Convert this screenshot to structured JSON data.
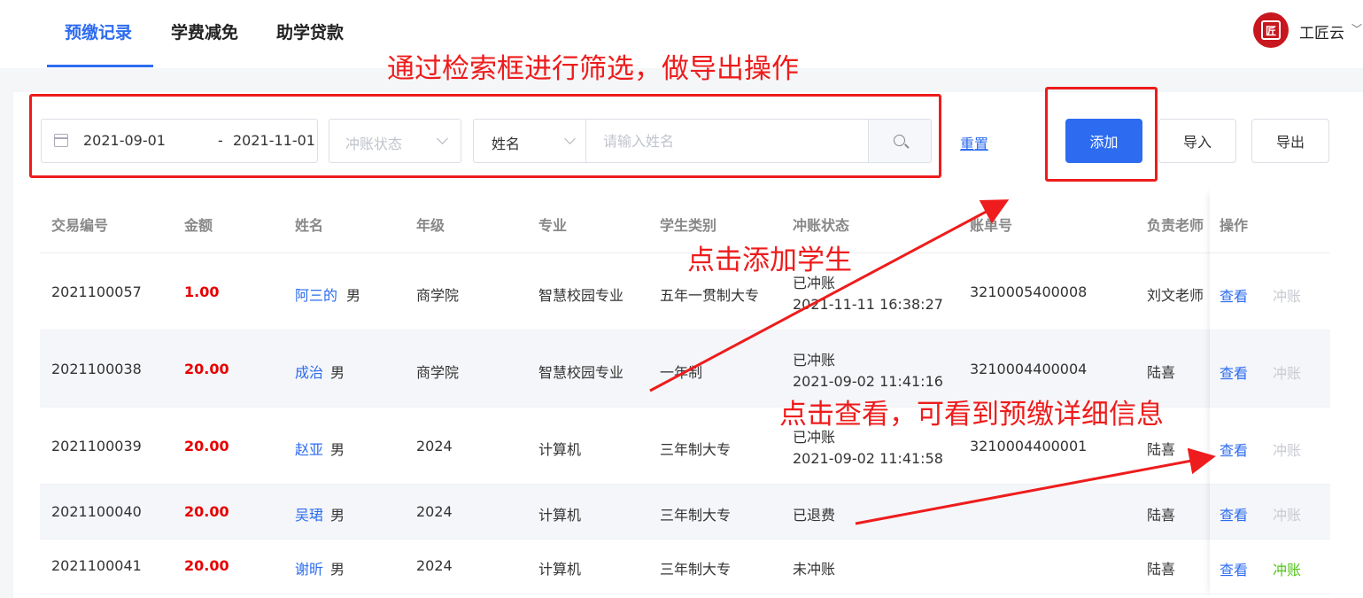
{
  "tabs": [
    {
      "label": "预缴记录",
      "active": true
    },
    {
      "label": "学费减免",
      "active": false
    },
    {
      "label": "助学贷款",
      "active": false
    }
  ],
  "brand": {
    "logo_char": "匠",
    "name": "工匠云"
  },
  "filters": {
    "date_start": "2021-09-01",
    "date_sep": "-",
    "date_end": "2021-11-01",
    "status_placeholder": "冲账状态",
    "search_field": "姓名",
    "name_placeholder": "请输入姓名"
  },
  "actions": {
    "reset": "重置",
    "add": "添加",
    "import": "导入",
    "export": "导出"
  },
  "table": {
    "headers": [
      "交易编号",
      "金额",
      "姓名",
      "年级",
      "专业",
      "学生类别",
      "冲账状态",
      "账单号",
      "负责老师",
      "操作"
    ],
    "rows": [
      {
        "id": "2021100057",
        "amount": "1.00",
        "name": "阿三的",
        "gender": "男",
        "grade": "商学院",
        "major": "智慧校园专业",
        "category": "五年一贯制大专",
        "status": "已冲账",
        "time": "2021-11-11 16:38:27",
        "bill": "3210005400008",
        "teacher": "刘文老师",
        "view": "查看",
        "reconcile": "冲账"
      },
      {
        "id": "2021100038",
        "amount": "20.00",
        "name": "成治",
        "gender": "男",
        "grade": "商学院",
        "major": "智慧校园专业",
        "category": "一年制",
        "status": "已冲账",
        "time": "2021-09-02 11:41:16",
        "bill": "3210004400004",
        "teacher": "陆喜",
        "view": "查看",
        "reconcile": "冲账"
      },
      {
        "id": "2021100039",
        "amount": "20.00",
        "name": "赵亚",
        "gender": "男",
        "grade": "2024",
        "major": "计算机",
        "category": "三年制大专",
        "status": "已冲账",
        "time": "2021-09-02 11:41:58",
        "bill": "3210004400001",
        "teacher": "陆喜",
        "view": "查看",
        "reconcile": "冲账"
      },
      {
        "id": "2021100040",
        "amount": "20.00",
        "name": "吴珺",
        "gender": "男",
        "grade": "2024",
        "major": "计算机",
        "category": "三年制大专",
        "status": "已退费",
        "time": "",
        "bill": "",
        "teacher": "陆喜",
        "view": "查看",
        "reconcile": "冲账"
      },
      {
        "id": "2021100041",
        "amount": "20.00",
        "name": "谢昕",
        "gender": "男",
        "grade": "2024",
        "major": "计算机",
        "category": "三年制大专",
        "status": "未冲账",
        "time": "",
        "bill": "",
        "teacher": "陆喜",
        "view": "查看",
        "reconcile": "冲账"
      }
    ]
  },
  "annotations": {
    "filter_note": "通过检索框进行筛选，做导出操作",
    "add_note": "点击添加学生",
    "view_note": "点击查看，可看到预缴详细信息"
  },
  "colors": {
    "primary": "#2d6cf0",
    "amount": "#e60000",
    "annotation": "#ee1c1c",
    "reconcile_active": "#52c41a",
    "reconcile_disabled": "#c8cbd2"
  }
}
